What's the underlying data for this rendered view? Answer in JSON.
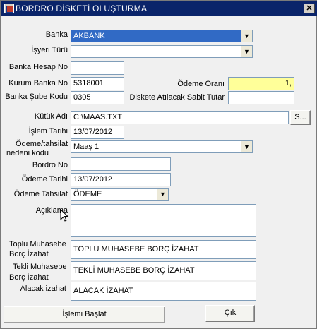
{
  "window": {
    "title": "BORDRO DİSKETİ OLUŞTURMA",
    "close_label": "✕"
  },
  "form": {
    "banka": {
      "label": "Banka",
      "value": "AKBANK"
    },
    "isyeri_turu": {
      "label": "İşyeri Türü",
      "value": ""
    },
    "banka_hesap_no": {
      "label": "Banka Hesap No",
      "value": ""
    },
    "kurum_banka_no": {
      "label": "Kurum Banka No",
      "value": "5318001"
    },
    "odeme_orani": {
      "label": "Ödeme Oranı",
      "value": "1,"
    },
    "banka_sube_kodu": {
      "label": "Banka Şube Kodu",
      "value": "0305"
    },
    "sabit_tutar": {
      "label": "Diskete Atılacak Sabit Tutar",
      "value": ""
    },
    "kutuk_adi": {
      "label": "Kütük Adı",
      "value": "C:\\MAAS.TXT",
      "browse_label": "S..."
    },
    "islem_tarihi": {
      "label": "İşlem Tarihi",
      "value": "13/07/2012"
    },
    "odeme_nedeni": {
      "label_line1": "Ödeme/tahsilat",
      "label_line2": "nedeni kodu",
      "value": "Maaş 1"
    },
    "bordro_no": {
      "label": "Bordro No",
      "value": ""
    },
    "odeme_tarihi": {
      "label": "Ödeme Tarihi",
      "value": "13/07/2012"
    },
    "odeme_tahsilat": {
      "label": "Ödeme Tahsilat",
      "value": "ÖDEME"
    },
    "aciklama": {
      "label": "Açıklama",
      "value": ""
    },
    "toplu_muhasebe": {
      "label_line1": "Toplu Muhasebe",
      "label_line2": "Borç İzahat",
      "value": "TOPLU MUHASEBE BORÇ İZAHAT"
    },
    "tekli_muhasebe": {
      "label_line1": "Tekli Muhasebe",
      "label_line2": "Borç İzahat",
      "value": "TEKLİ MUHASEBE BORÇ İZAHAT"
    },
    "alacak_izahat": {
      "label": "Alacak izahat",
      "value": "ALACAK İZAHAT"
    }
  },
  "buttons": {
    "islemi_baslat": "İşlemi Başlat",
    "cik": "Çık"
  },
  "icons": {
    "dropdown": "▼"
  },
  "colors": {
    "titlebar": "#0a246a",
    "selection": "#316ac5",
    "highlight_field": "#ffff99"
  }
}
